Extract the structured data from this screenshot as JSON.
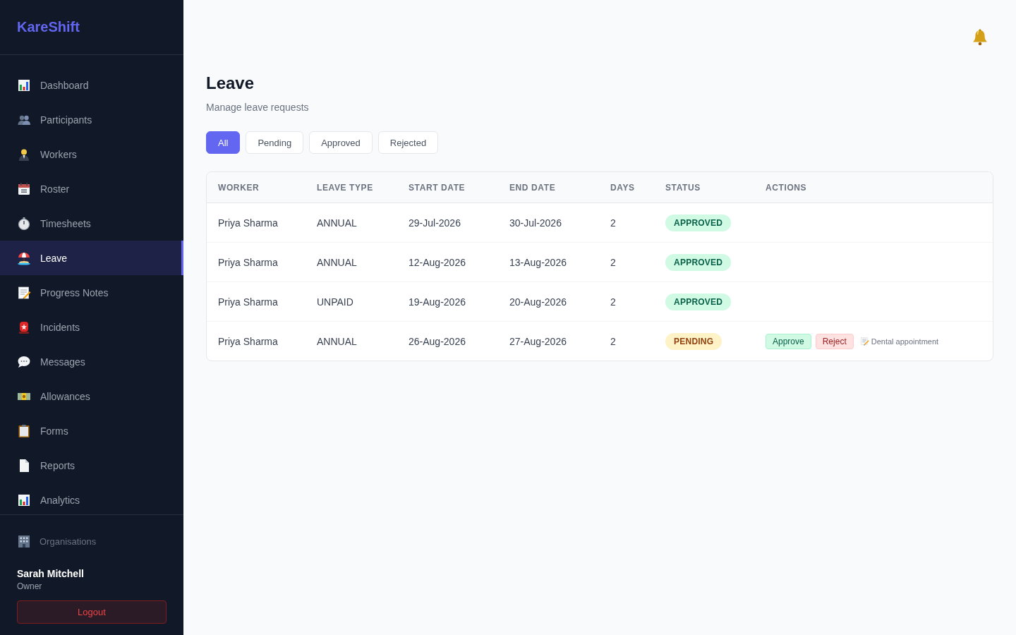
{
  "sidebar": {
    "logo": "KareShift",
    "items": [
      {
        "label": "Dashboard",
        "selected": false
      },
      {
        "label": "Participants",
        "selected": false
      },
      {
        "label": "Workers",
        "selected": false
      },
      {
        "label": "Roster",
        "selected": false
      },
      {
        "label": "Timesheets",
        "selected": false
      },
      {
        "label": "Leave",
        "selected": true
      },
      {
        "label": "Progress Notes",
        "selected": false
      },
      {
        "label": "Incidents",
        "selected": false
      },
      {
        "label": "Messages",
        "selected": false
      },
      {
        "label": "Allowances",
        "selected": false
      },
      {
        "label": "Forms",
        "selected": false
      },
      {
        "label": "Reports",
        "selected": false
      },
      {
        "label": "Analytics",
        "selected": false
      }
    ],
    "organisations": "Organisations",
    "user": {
      "name": "Sarah Mitchell",
      "role": "Owner"
    },
    "logout": "Logout"
  },
  "page": {
    "title": "Leave",
    "subtitle": "Manage leave requests"
  },
  "filters": [
    {
      "label": "All",
      "selected": true
    },
    {
      "label": "Pending",
      "selected": false
    },
    {
      "label": "Approved",
      "selected": false
    },
    {
      "label": "Rejected",
      "selected": false
    }
  ],
  "table": {
    "columns": [
      "WORKER",
      "LEAVE TYPE",
      "START DATE",
      "END DATE",
      "DAYS",
      "STATUS",
      "ACTIONS"
    ],
    "rows": [
      {
        "worker": "Priya Sharma",
        "leave_type": "ANNUAL",
        "start_date": "29-Jul-2026",
        "end_date": "30-Jul-2026",
        "days": "2",
        "status": {
          "text": "APPROVED",
          "kind": "approved"
        }
      },
      {
        "worker": "Priya Sharma",
        "leave_type": "ANNUAL",
        "start_date": "12-Aug-2026",
        "end_date": "13-Aug-2026",
        "days": "2",
        "status": {
          "text": "APPROVED",
          "kind": "approved"
        }
      },
      {
        "worker": "Priya Sharma",
        "leave_type": "UNPAID",
        "start_date": "19-Aug-2026",
        "end_date": "20-Aug-2026",
        "days": "2",
        "status": {
          "text": "APPROVED",
          "kind": "approved"
        }
      },
      {
        "worker": "Priya Sharma",
        "leave_type": "ANNUAL",
        "start_date": "26-Aug-2026",
        "end_date": "27-Aug-2026",
        "days": "2",
        "status": {
          "text": "PENDING",
          "kind": "pending"
        },
        "actions": [
          {
            "label": "Approve",
            "kind": "approve"
          },
          {
            "label": "Reject",
            "kind": "reject"
          }
        ],
        "note": "Dental appointment"
      }
    ]
  }
}
